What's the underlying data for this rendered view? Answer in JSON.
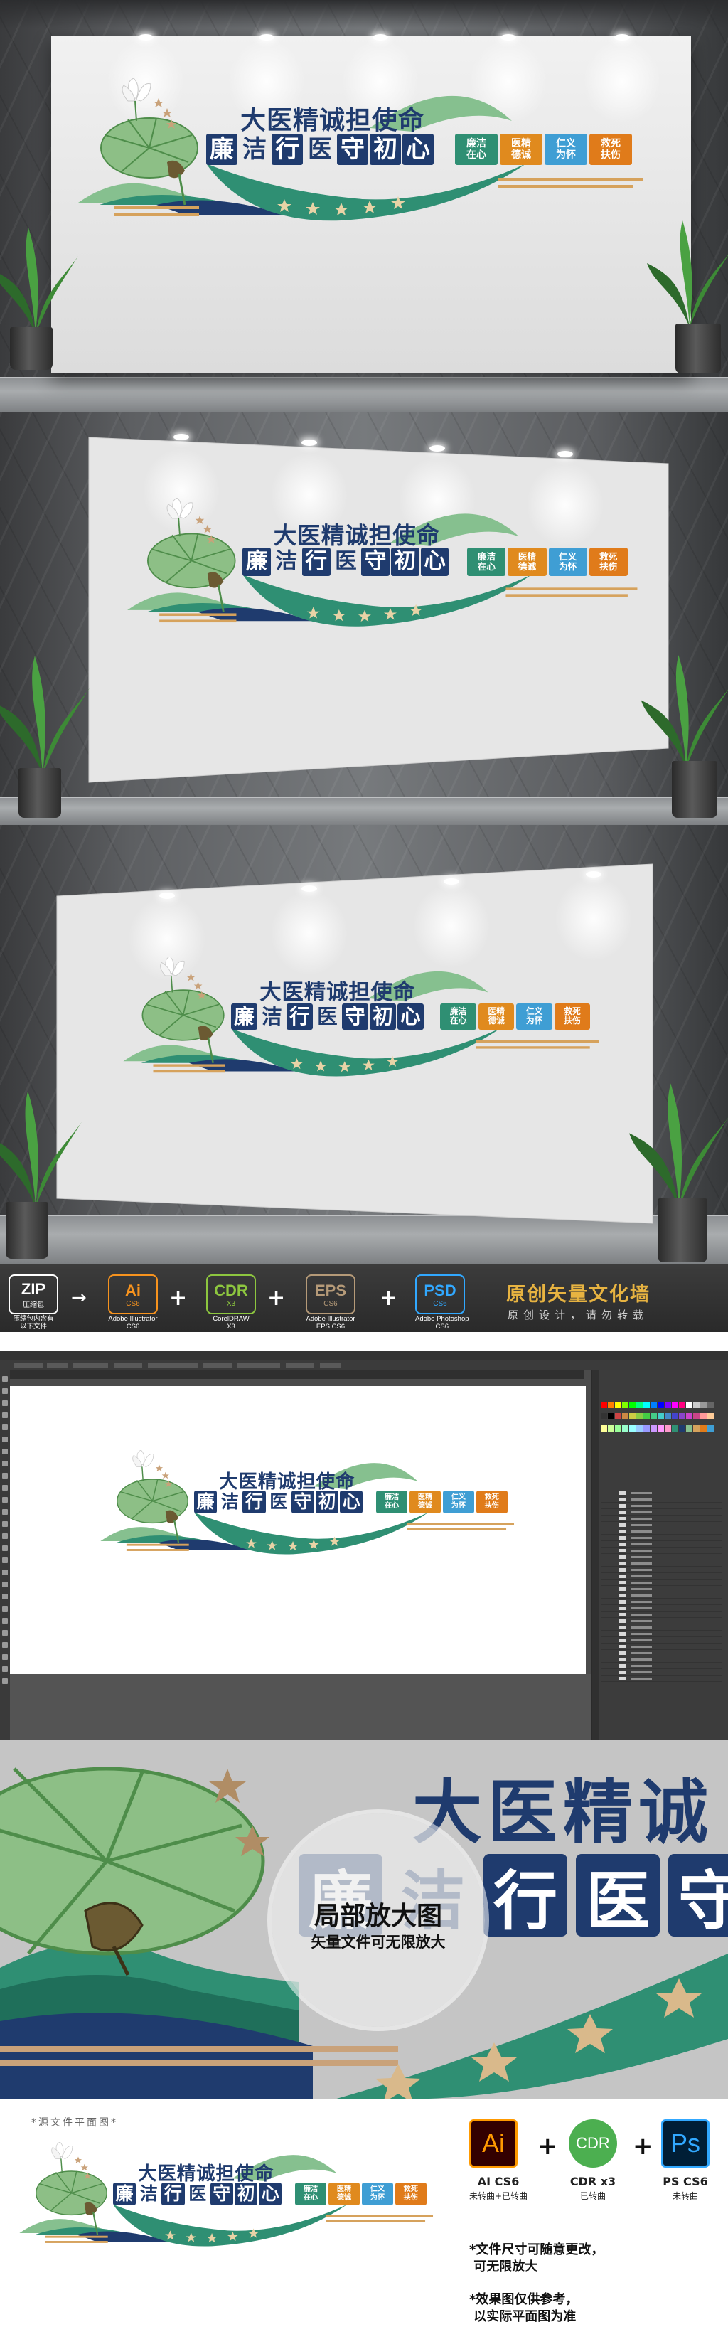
{
  "logo": {
    "title": "大医精诚担使命",
    "subtitle_chars": [
      "廉",
      "洁",
      "行",
      "医",
      "守",
      "初",
      "心"
    ],
    "tags": [
      {
        "text": "廉洁\n在心",
        "color": "#2f8f73"
      },
      {
        "text": "医精\n德诚",
        "color": "#e08a1e"
      },
      {
        "text": "仁义\n为怀",
        "color": "#3f9ed4"
      },
      {
        "text": "救死\n扶伤",
        "color": "#e07b1a"
      }
    ],
    "colors": {
      "navy": "#1f3b6e",
      "green": "#2f8f73",
      "light_green": "#86c08f",
      "gold": "#d6a25c"
    }
  },
  "formats": {
    "items": [
      {
        "label": "ZIP",
        "sub": "压缩包",
        "caption": "压缩包内含有\n以下文件",
        "color": "#ffffff"
      },
      {
        "label": "Ai",
        "sub": "CS6",
        "caption": "Adobe Illustrator\nCS6",
        "color": "#f7931e"
      },
      {
        "label": "CDR",
        "sub": "X3",
        "caption": "CorelDRAW\nX3",
        "color": "#8dc63f"
      },
      {
        "label": "EPS",
        "sub": "CS6",
        "caption": "Adobe Illustrator\nEPS CS6",
        "color": "#b59a78"
      },
      {
        "label": "PSD",
        "sub": "CS6",
        "caption": "Adobe Photoshop\nCS6",
        "color": "#31a8ff"
      }
    ],
    "brand": "原创矢量文化墙",
    "brand_sub": "原创设计，请勿转载"
  },
  "zoom": {
    "title": "大医精诚",
    "subtitle_chars": [
      "廉",
      "洁",
      "行",
      "医",
      "守"
    ],
    "lens_title": "局部放大图",
    "lens_sub": "矢量文件可无限放大"
  },
  "source": {
    "label": "*源文件平面图*",
    "software": [
      {
        "icon": "Ai",
        "name": "AI CS6",
        "note": "未转曲+已转曲",
        "color": "#ff9a00",
        "bg": "#330000"
      },
      {
        "icon": "CDR",
        "name": "CDR x3",
        "note": "已转曲",
        "color": "#ffffff",
        "bg": "#4caf50"
      },
      {
        "icon": "Ps",
        "name": "PS CS6",
        "note": "未转曲",
        "color": "#31a8ff",
        "bg": "#001e36"
      }
    ],
    "note1": "*文件尺寸可随意更改，\n 可无限放大",
    "note2": "*效果图仅供参考，\n 以实际平面图为准"
  }
}
